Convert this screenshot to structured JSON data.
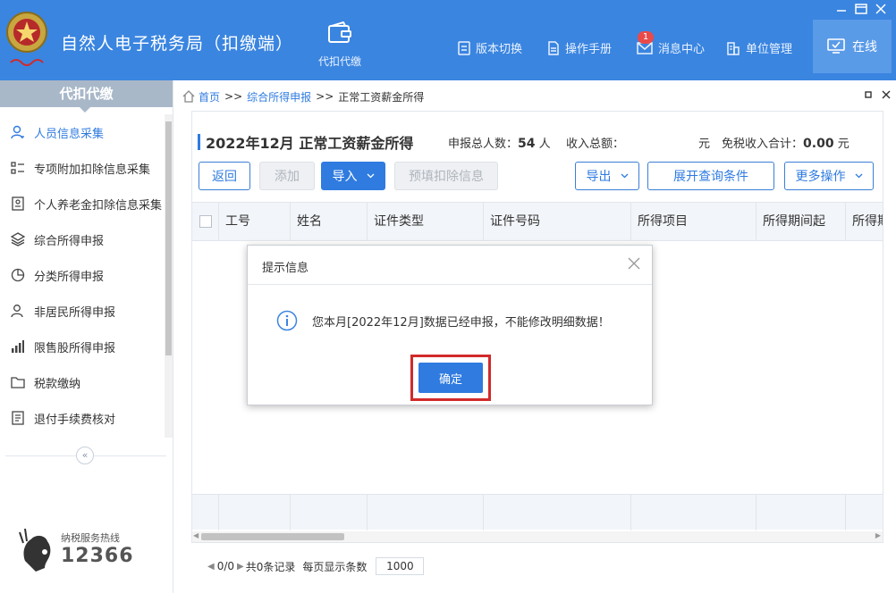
{
  "app": {
    "title": "自然人电子税务局（扣缴端）",
    "brand_color": "#3a85e0",
    "accent_color": "#2f7be0",
    "logo_icon": "tax-emblem-icon"
  },
  "header": {
    "main_nav_label": "代扣代缴",
    "links": {
      "version": "版本切换",
      "manual": "操作手册",
      "messages": "消息中心",
      "unit": "单位管理"
    },
    "message_badge": "1",
    "online_label": "在线"
  },
  "sidebar": {
    "title": "代扣代缴",
    "items": [
      {
        "label": "人员信息采集",
        "icon": "person-icon",
        "active": true
      },
      {
        "label": "专项附加扣除信息采集",
        "icon": "list-icon",
        "active": false
      },
      {
        "label": "个人养老金扣除信息采集",
        "icon": "document-person-icon",
        "active": false
      },
      {
        "label": "综合所得申报",
        "icon": "layers-icon",
        "active": false
      },
      {
        "label": "分类所得申报",
        "icon": "pie-chart-icon",
        "active": false
      },
      {
        "label": "非居民所得申报",
        "icon": "person-outline-icon",
        "active": false
      },
      {
        "label": "限售股所得申报",
        "icon": "bar-chart-icon",
        "active": false
      },
      {
        "label": "税款缴纳",
        "icon": "folder-icon",
        "active": false
      },
      {
        "label": "退付手续费核对",
        "icon": "doc-check-icon",
        "active": false
      }
    ],
    "collapse_glyph": "«",
    "hotline_label": "纳税服务热线",
    "hotline_number": "12366"
  },
  "breadcrumb": {
    "home": "首页",
    "sep": ">>",
    "level1": "综合所得申报",
    "current": "正常工资薪金所得"
  },
  "panel": {
    "title": "2022年12月 正常工资薪金所得",
    "total_people_label": "申报总人数：",
    "total_people_value": "54",
    "total_people_unit": "人",
    "income_label": "收入总额：",
    "income_unit": "元",
    "exempt_label": "免税收入合计：",
    "exempt_value": "0.00",
    "exempt_unit": "元"
  },
  "toolbar": {
    "back": "返回",
    "add": "添加",
    "import": "导入",
    "prefill": "预填扣除信息",
    "export": "导出",
    "expand_query": "展开查询条件",
    "more": "更多操作"
  },
  "table": {
    "columns": [
      "工号",
      "姓名",
      "证件类型",
      "证件号码",
      "所得项目",
      "所得期间起",
      "所得期"
    ]
  },
  "pager": {
    "page": "0/0",
    "records": "共0条记录",
    "per_page_label": "每页显示条数",
    "per_page_value": "1000"
  },
  "dialog": {
    "title": "提示信息",
    "message": "您本月[2022年12月]数据已经申报，不能修改明细数据！",
    "ok": "确定",
    "highlight_color": "#d12a2a"
  }
}
